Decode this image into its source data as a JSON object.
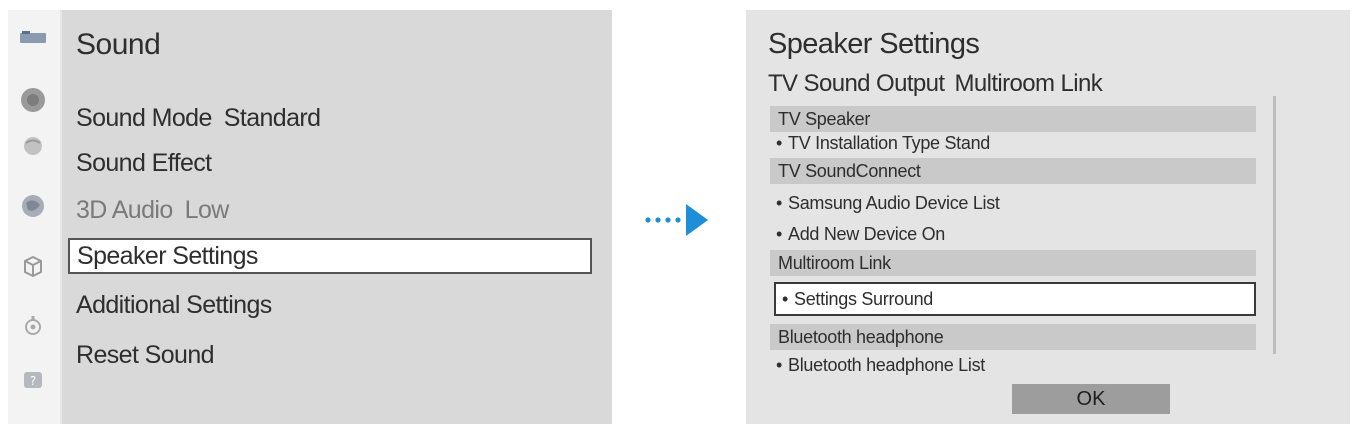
{
  "sound_menu": {
    "title": "Sound",
    "items": [
      {
        "label": "Sound Mode",
        "value": "Standard"
      },
      {
        "label": "Sound Effect",
        "value": ""
      },
      {
        "label": "3D Audio",
        "value": "Low"
      },
      {
        "label": "Speaker Settings",
        "value": ""
      },
      {
        "label": "Additional Settings",
        "value": ""
      },
      {
        "label": "Reset Sound",
        "value": ""
      }
    ],
    "selected_index": 3,
    "side_icons": [
      "picture-icon",
      "sound-icon",
      "broadcast-icon",
      "network-icon",
      "smart-features-icon",
      "system-icon",
      "support-icon"
    ]
  },
  "arrow": {
    "icon": "dotted-arrow-right-icon",
    "color": "#1e8ed8"
  },
  "speaker_settings": {
    "title": "Speaker Settings",
    "tabs": [
      "TV Sound Output",
      "Multiroom Link"
    ],
    "sections": [
      {
        "header": "TV Speaker",
        "items": [
          "TV Installation Type Stand"
        ]
      },
      {
        "header": "TV SoundConnect",
        "items": [
          "Samsung Audio Device List",
          "Add New Device On"
        ]
      },
      {
        "header": "Multiroom Link",
        "items": [
          "Settings Surround"
        ]
      },
      {
        "header": "Bluetooth headphone",
        "items": [
          "Bluetooth headphone List"
        ]
      }
    ],
    "ok_label": "OK"
  }
}
